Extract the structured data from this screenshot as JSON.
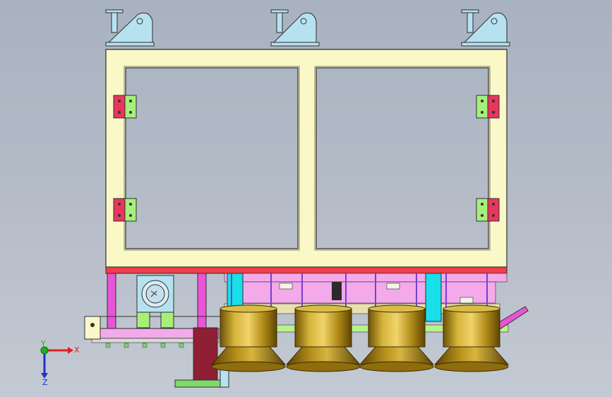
{
  "view": {
    "type": "cad-assembly-view",
    "background_top": "#a9b2c0",
    "background_bottom": "#c4cad3"
  },
  "colors": {
    "frame": "#fbf8c8",
    "frame_edge": "#2f2f2f",
    "mount": "#b6e2f0",
    "hinge_red": "#e8365d",
    "hinge_green": "#a6f07a",
    "rail_red": "#ef3f48",
    "magenta": "#e855d6",
    "pink": "#f3a9ea",
    "cyan": "#18dfe8",
    "gold": "#c7a21b",
    "gold_dark": "#7a5d06",
    "maroon": "#8e1f35",
    "green": "#80d96b"
  },
  "triad": {
    "x_label": "X",
    "y_label": "Y",
    "z_label": "Z",
    "x_color": "#e02020",
    "y_color": "#20b020",
    "z_color": "#2030d0"
  },
  "parts": {
    "frame": "main-frame",
    "mounts": [
      "mount-left",
      "mount-center",
      "mount-right"
    ],
    "hinges": [
      "hinge-top-left",
      "hinge-top-right",
      "hinge-bottom-left",
      "hinge-bottom-right"
    ],
    "motor": "motor-unit",
    "cups": [
      "cup-1",
      "cup-2",
      "cup-3",
      "cup-4"
    ]
  }
}
